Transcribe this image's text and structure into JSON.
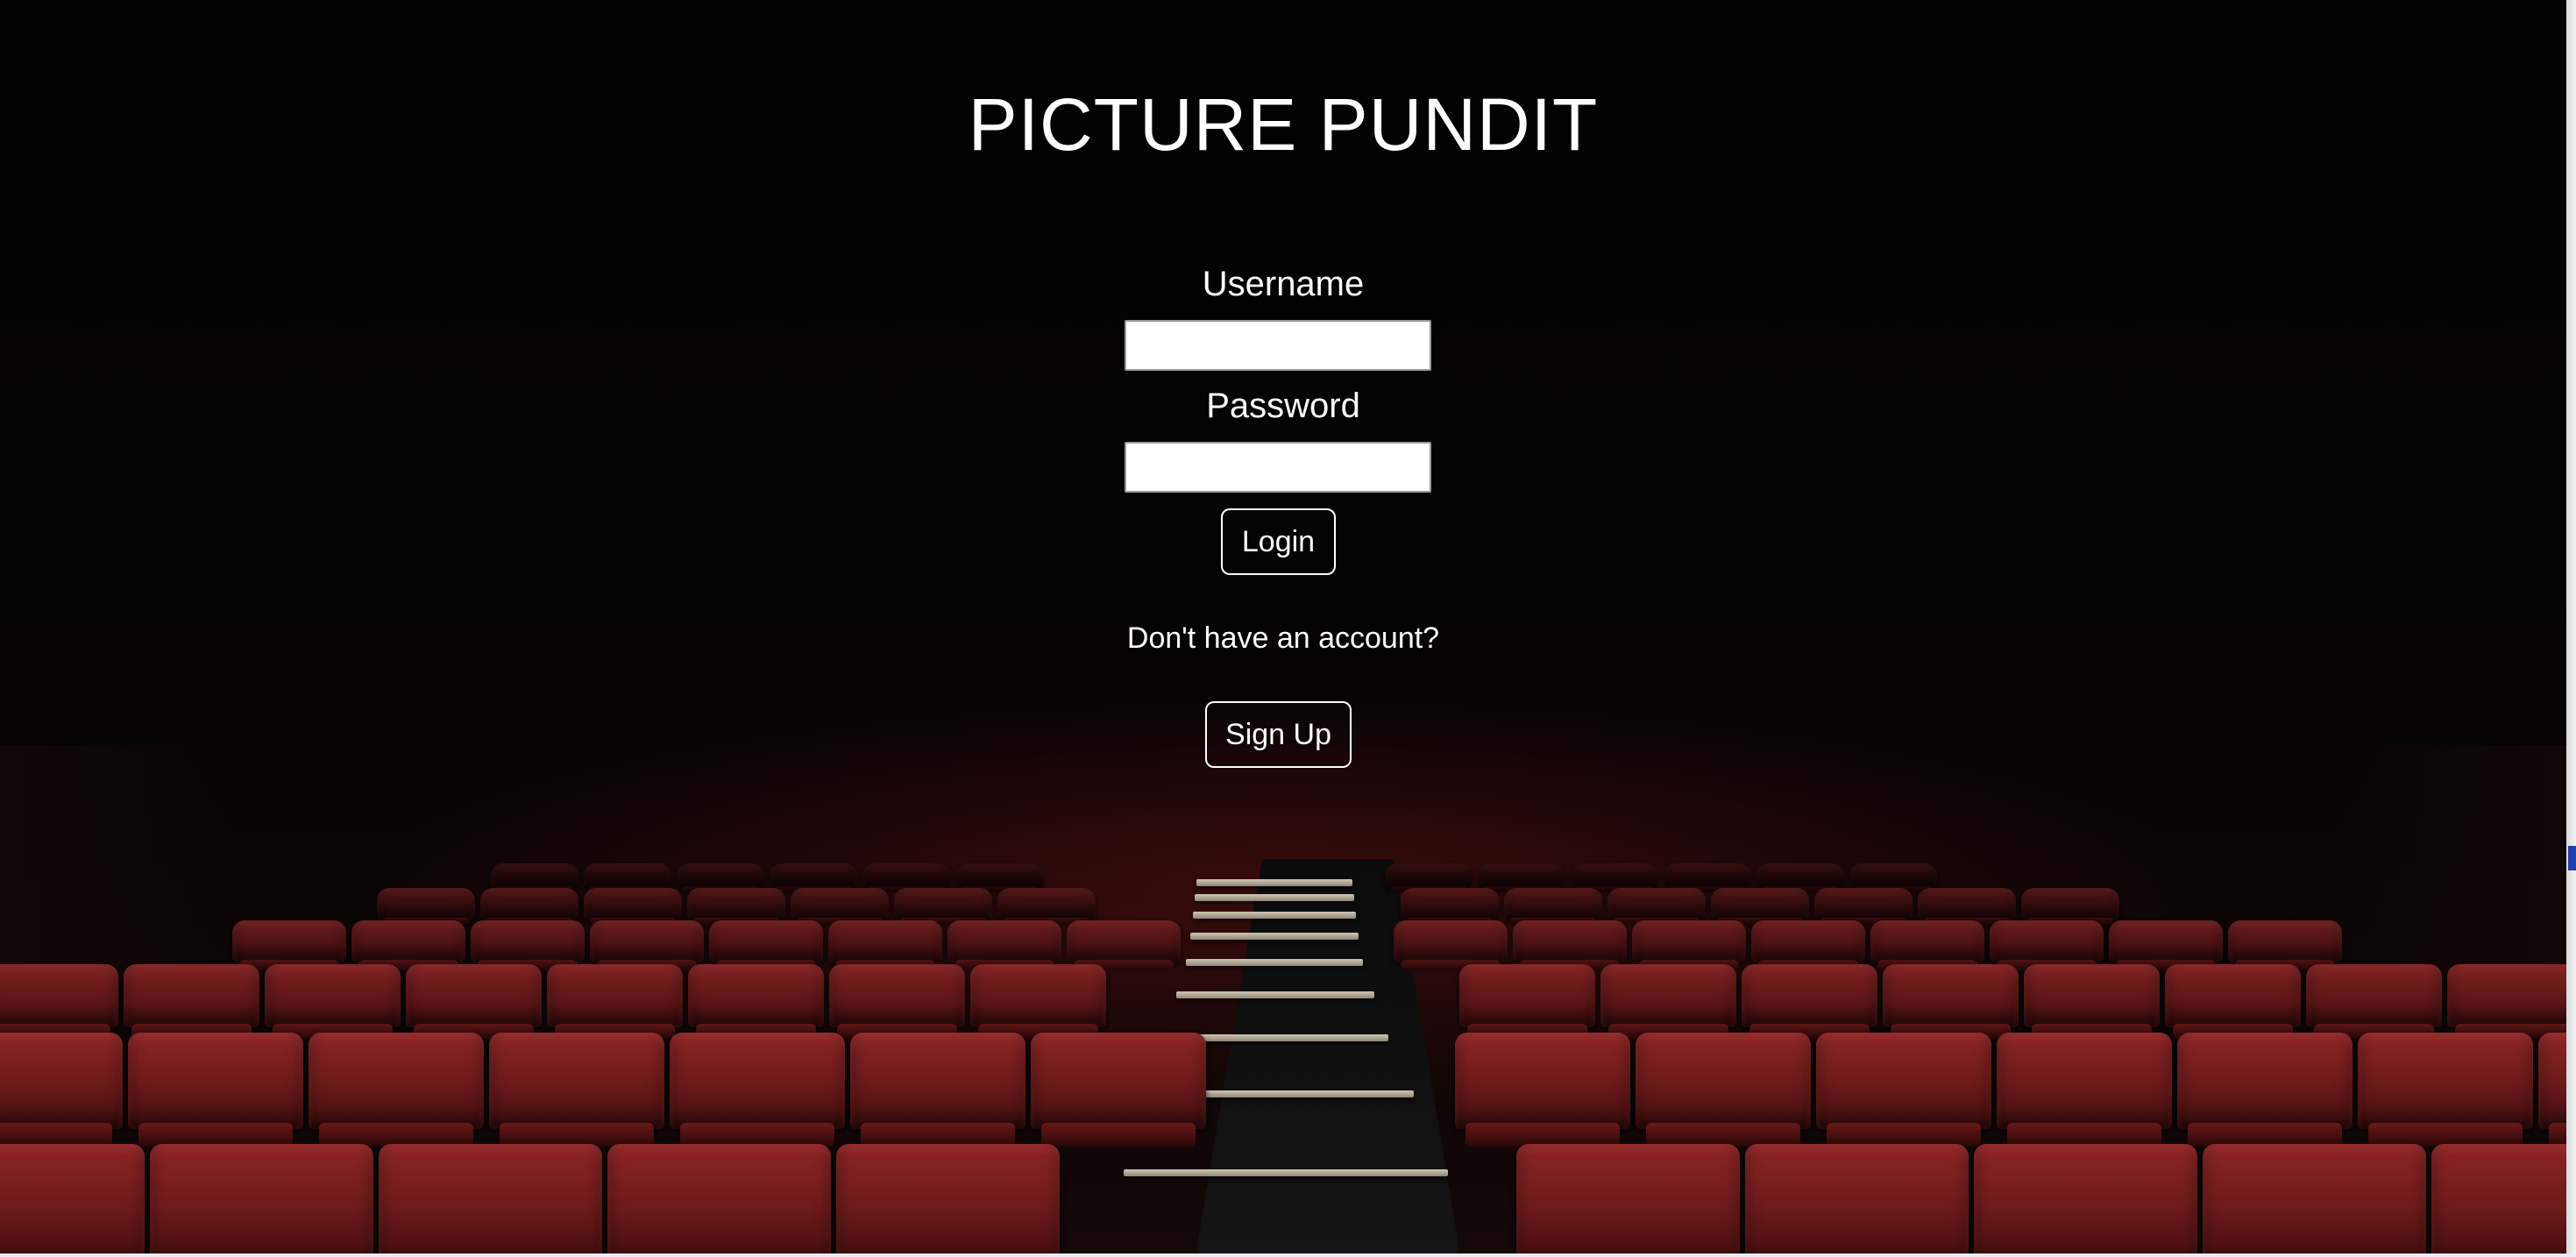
{
  "app": {
    "title": "PICTURE PUNDIT"
  },
  "login_form": {
    "username_label": "Username",
    "username_value": "",
    "password_label": "Password",
    "password_value": "",
    "login_button_label": "Login"
  },
  "signup": {
    "prompt": "Don't have an account?",
    "button_label": "Sign Up"
  },
  "background": {
    "subject": "cinema-seats",
    "seat_color": "#7a1c1c",
    "page_color": "#020202",
    "text_color": "#ffffff"
  }
}
